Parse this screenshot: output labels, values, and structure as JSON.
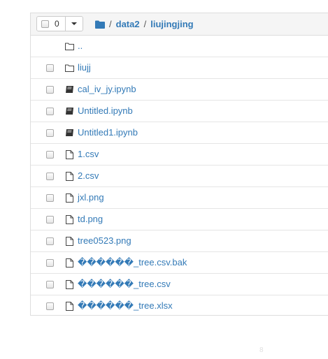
{
  "toolbar": {
    "selected_count": "0"
  },
  "breadcrumb": {
    "separator": "/",
    "items": [
      {
        "label": "data2"
      },
      {
        "label": "liujingjing"
      }
    ]
  },
  "files": [
    {
      "name": "..",
      "type": "folder",
      "checkbox": false
    },
    {
      "name": "liujj",
      "type": "folder",
      "checkbox": true
    },
    {
      "name": "cal_iv_jy.ipynb",
      "type": "notebook",
      "checkbox": true
    },
    {
      "name": "Untitled.ipynb",
      "type": "notebook",
      "checkbox": true
    },
    {
      "name": "Untitled1.ipynb",
      "type": "notebook",
      "checkbox": true
    },
    {
      "name": "1.csv",
      "type": "file",
      "checkbox": true
    },
    {
      "name": "2.csv",
      "type": "file",
      "checkbox": true
    },
    {
      "name": "jxl.png",
      "type": "file",
      "checkbox": true
    },
    {
      "name": "td.png",
      "type": "file",
      "checkbox": true
    },
    {
      "name": "tree0523.png",
      "type": "file",
      "checkbox": true
    },
    {
      "name": "������_tree.csv.bak",
      "type": "file",
      "checkbox": true
    },
    {
      "name": "������_tree.csv",
      "type": "file",
      "checkbox": true
    },
    {
      "name": "������_tree.xlsx",
      "type": "file",
      "checkbox": true
    }
  ],
  "footer_mark": "8",
  "colors": {
    "link": "#337ab7",
    "header_bg": "#f5f5f5",
    "border": "#dddddd"
  }
}
